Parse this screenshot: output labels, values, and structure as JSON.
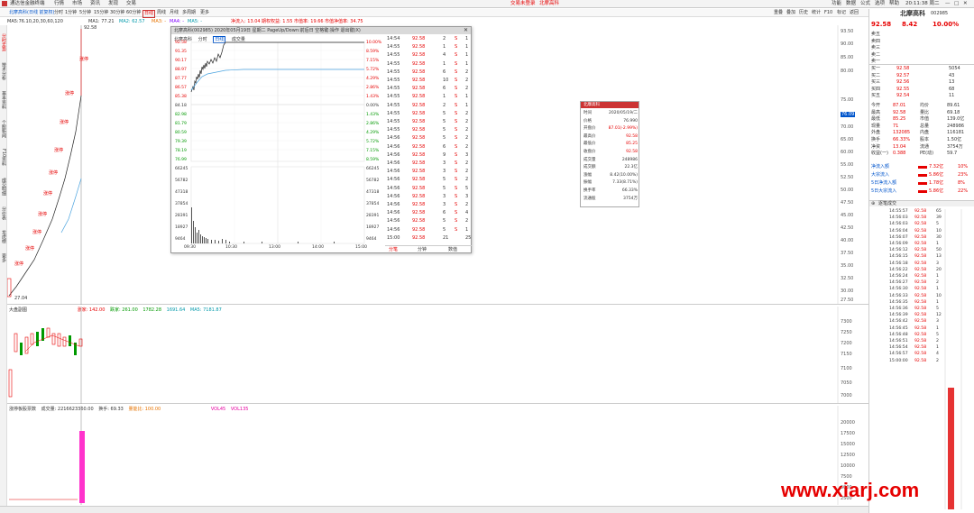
{
  "titlebar": {
    "app_name": "通达信金融终端",
    "menus": [
      "行情",
      "市场",
      "资讯",
      "发现",
      "交易"
    ],
    "status_text": "交易未登录",
    "stock_name": "北摩高科",
    "right_items": [
      "功能",
      "数据",
      "公式",
      "选项",
      "帮助"
    ],
    "clock": "20:11:38 周二"
  },
  "toolbar": {
    "left_items": [
      "北摩高科(日线 前复权)",
      "MA5",
      "MA10",
      "MA20",
      "MA30",
      "MA60",
      "MA120"
    ],
    "periods": [
      "分时",
      "1分钟",
      "5分钟",
      "15分钟",
      "30分钟",
      "60分钟",
      "日线",
      "周线",
      "月线",
      "多周期",
      "更多"
    ],
    "right_items": [
      "重叠",
      "叠加",
      "历史",
      "统计",
      "F10",
      "标记",
      "返回"
    ]
  },
  "infobar": {
    "ma_text": "MA5:76.10,20,30,60,120",
    "ma1": "MA1: 77.21",
    "ma2": "MA2: 62.57",
    "ma3": "MA3: -",
    "ma4": "MA4: -",
    "ma5": "MA5: -",
    "flow1": "净流入: 13.04",
    "flow2": "期权权益: 1.55",
    "flow3": "市值率: 19.66",
    "flow4": "市值净值率: 34.75"
  },
  "lefttabs": [
    "分时走势",
    "技术分析",
    "基本资料",
    "个股新闻",
    "F10资料",
    "成交明细",
    "分价表",
    "龙虎榜",
    "更多"
  ],
  "mainchart": {
    "top_price": "92.58",
    "low_price": "27.04",
    "labels": [
      "涨停",
      "涨停",
      "涨停",
      "涨停",
      "涨停",
      "涨停",
      "涨停",
      "涨停",
      "涨停",
      "涨停"
    ],
    "axis": [
      "93.50",
      "90.00",
      "85.00",
      "80.00",
      "76.09",
      "75.00",
      "70.00",
      "65.00",
      "60.00",
      "55.00",
      "52.50",
      "50.00",
      "47.50",
      "45.00",
      "42.50",
      "40.00",
      "37.50",
      "35.00",
      "32.50",
      "30.00",
      "27.50"
    ]
  },
  "volchart": {
    "title": "大盘副图",
    "axis": [
      "7300",
      "7250",
      "7200",
      "7150",
      "7100",
      "7050",
      "7000"
    ],
    "vals": [
      "涨家: 142.00",
      "跌家: 261.00",
      "1782.28",
      "1691.64",
      "MA5: 7181.87"
    ]
  },
  "indchart": {
    "title": "涨停板股票数",
    "vals": [
      "成交量: 2216623360.00",
      "换手: 69.33",
      "量能比: 100.00",
      "VOL45",
      "VOL135"
    ],
    "axis": [
      "20000",
      "17500",
      "15000",
      "12500",
      "10000",
      "7500",
      "5000",
      "2500"
    ]
  },
  "popup": {
    "title": "北摩高科(002985)  2020年05月19日  星期二  PageUp/Down:前后日  空格键:操作  退出键(X)",
    "tabs": [
      "北摩高科",
      "分时",
      "日线",
      "成交量"
    ],
    "left_axis": [
      "92.58",
      "91.35",
      "90.17",
      "88.97",
      "87.77",
      "86.57",
      "85.38",
      "84.18",
      "82.98",
      "81.79",
      "80.59",
      "79.39",
      "78.19",
      "76.99"
    ],
    "right_axis": [
      "10.00%",
      "8.59%",
      "7.15%",
      "5.72%",
      "4.29%",
      "2.86%",
      "1.43%",
      "0.00%",
      "1.43%",
      "2.86%",
      "4.29%",
      "5.72%",
      "7.15%",
      "8.59%"
    ],
    "vol_axis": [
      "66245",
      "56782",
      "47318",
      "37854",
      "28391",
      "18927",
      "9464"
    ],
    "time_axis": [
      "09:30",
      "10:30",
      "13:00",
      "14:00",
      "15:00"
    ],
    "ticks": [
      {
        "t": "14:54",
        "p": "92.58",
        "v": "2",
        "d": "S",
        "n": "1"
      },
      {
        "t": "14:55",
        "p": "92.58",
        "v": "1",
        "d": "S",
        "n": "1"
      },
      {
        "t": "14:55",
        "p": "92.58",
        "v": "4",
        "d": "S",
        "n": "1"
      },
      {
        "t": "14:55",
        "p": "92.58",
        "v": "1",
        "d": "S",
        "n": "1"
      },
      {
        "t": "14:55",
        "p": "92.58",
        "v": "6",
        "d": "S",
        "n": "2"
      },
      {
        "t": "14:55",
        "p": "92.58",
        "v": "10",
        "d": "S",
        "n": "2"
      },
      {
        "t": "14:55",
        "p": "92.58",
        "v": "6",
        "d": "S",
        "n": "2"
      },
      {
        "t": "14:55",
        "p": "92.58",
        "v": "1",
        "d": "S",
        "n": "1"
      },
      {
        "t": "14:55",
        "p": "92.58",
        "v": "2",
        "d": "S",
        "n": "1"
      },
      {
        "t": "14:55",
        "p": "92.58",
        "v": "5",
        "d": "S",
        "n": "2"
      },
      {
        "t": "14:55",
        "p": "92.58",
        "v": "5",
        "d": "S",
        "n": "2"
      },
      {
        "t": "14:55",
        "p": "92.58",
        "v": "5",
        "d": "S",
        "n": "2"
      },
      {
        "t": "14:56",
        "p": "92.58",
        "v": "5",
        "d": "S",
        "n": "2"
      },
      {
        "t": "14:56",
        "p": "92.58",
        "v": "6",
        "d": "S",
        "n": "2"
      },
      {
        "t": "14:56",
        "p": "92.58",
        "v": "9",
        "d": "S",
        "n": "3"
      },
      {
        "t": "14:56",
        "p": "92.58",
        "v": "3",
        "d": "S",
        "n": "2"
      },
      {
        "t": "14:56",
        "p": "92.58",
        "v": "3",
        "d": "S",
        "n": "2"
      },
      {
        "t": "14:56",
        "p": "92.58",
        "v": "5",
        "d": "S",
        "n": "2"
      },
      {
        "t": "14:56",
        "p": "92.58",
        "v": "5",
        "d": "S",
        "n": "5"
      },
      {
        "t": "14:56",
        "p": "92.58",
        "v": "3",
        "d": "S",
        "n": "3"
      },
      {
        "t": "14:56",
        "p": "92.58",
        "v": "3",
        "d": "S",
        "n": "2"
      },
      {
        "t": "14:56",
        "p": "92.58",
        "v": "6",
        "d": "S",
        "n": "4"
      },
      {
        "t": "14:56",
        "p": "92.58",
        "v": "5",
        "d": "S",
        "n": "2"
      },
      {
        "t": "14:56",
        "p": "92.58",
        "v": "5",
        "d": "S",
        "n": "1"
      },
      {
        "t": "15:00",
        "p": "92.58",
        "v": "21",
        "d": "",
        "n": "25"
      }
    ],
    "foot": [
      "分笔",
      "分钟",
      "数值"
    ]
  },
  "tooltip": {
    "title": "北摩高科",
    "rows": [
      {
        "k": "时间",
        "v": "2020/05/19/二"
      },
      {
        "k": "价格",
        "v": "76.990"
      },
      {
        "k": "开盘价",
        "v": "87.01(-2.99%)"
      },
      {
        "k": "最高价",
        "v": "92.58"
      },
      {
        "k": "最低价",
        "v": "85.25"
      },
      {
        "k": "收盘价",
        "v": "92.58"
      },
      {
        "k": "成交量",
        "v": "248986"
      },
      {
        "k": "成交额",
        "v": "22.3亿"
      },
      {
        "k": "涨幅",
        "v": "8.42(10.00%)"
      },
      {
        "k": "振幅",
        "v": "7.33(8.71%)"
      },
      {
        "k": "换手率",
        "v": "66.33%"
      },
      {
        "k": "流通股",
        "v": "3754万"
      }
    ]
  },
  "rightpanel": {
    "name": "北摩高科",
    "code": "002985",
    "price": "92.58",
    "change": "8.42",
    "pct": "10.00%",
    "sells": [
      {
        "k": "卖五",
        "p": "",
        "v": ""
      },
      {
        "k": "卖四",
        "p": "",
        "v": ""
      },
      {
        "k": "卖三",
        "p": "",
        "v": ""
      },
      {
        "k": "卖二",
        "p": "",
        "v": ""
      },
      {
        "k": "卖一",
        "p": "",
        "v": ""
      }
    ],
    "buys": [
      {
        "k": "买一",
        "p": "92.58",
        "v": "5054"
      },
      {
        "k": "买二",
        "p": "92.57",
        "v": "43"
      },
      {
        "k": "买三",
        "p": "92.56",
        "v": "13"
      },
      {
        "k": "买四",
        "p": "92.55",
        "v": "68"
      },
      {
        "k": "买五",
        "p": "92.54",
        "v": "11"
      }
    ],
    "stats": [
      {
        "k": "今开",
        "v": "87.01",
        "k2": "均价",
        "v2": "89.61"
      },
      {
        "k": "最高",
        "v": "92.58",
        "k2": "量比",
        "v2": "69.18"
      },
      {
        "k": "最低",
        "v": "85.25",
        "k2": "市值",
        "v2": "139.0亿"
      },
      {
        "k": "现量",
        "v": "71",
        "k2": "总量",
        "v2": "248986"
      },
      {
        "k": "外盘",
        "v": "132085",
        "k2": "内盘",
        "v2": "116181"
      },
      {
        "k": "换手",
        "v": "66.33%",
        "k2": "股本",
        "v2": "1.50亿"
      },
      {
        "k": "净资",
        "v": "13.04",
        "k2": "流通",
        "v2": "3754万"
      },
      {
        "k": "收益(一)",
        "v": "0.388",
        "k2": "PE(动)",
        "v2": "59.7"
      }
    ],
    "flows": [
      {
        "k": "净流入额",
        "v": "7.32亿",
        "p": "10%"
      },
      {
        "k": "大宗流入",
        "v": "5.86亿",
        "p": "23%"
      },
      {
        "k": "5日净流入额",
        "v": "1.78亿",
        "p": "8%"
      },
      {
        "k": "5日大宗流入",
        "v": "5.86亿",
        "p": "22%"
      }
    ],
    "trades_title": "逐笔成交",
    "trades": [
      {
        "t": "14:55:57",
        "p": "92.58",
        "v": "65"
      },
      {
        "t": "14:56:03",
        "p": "92.58",
        "v": "39"
      },
      {
        "t": "14:56:03",
        "p": "92.58",
        "v": "5"
      },
      {
        "t": "14:56:04",
        "p": "92.58",
        "v": "10"
      },
      {
        "t": "14:56:07",
        "p": "92.58",
        "v": "30"
      },
      {
        "t": "14:56:09",
        "p": "92.58",
        "v": "1"
      },
      {
        "t": "14:56:12",
        "p": "92.58",
        "v": "50"
      },
      {
        "t": "14:56:15",
        "p": "92.58",
        "v": "13"
      },
      {
        "t": "14:56:18",
        "p": "92.58",
        "v": "3"
      },
      {
        "t": "14:56:22",
        "p": "92.58",
        "v": "20"
      },
      {
        "t": "14:56:24",
        "p": "92.58",
        "v": "1"
      },
      {
        "t": "14:56:27",
        "p": "92.58",
        "v": "2"
      },
      {
        "t": "14:56:30",
        "p": "92.58",
        "v": "1"
      },
      {
        "t": "14:56:33",
        "p": "92.58",
        "v": "10"
      },
      {
        "t": "14:56:35",
        "p": "92.58",
        "v": "1"
      },
      {
        "t": "14:56:36",
        "p": "92.58",
        "v": "5"
      },
      {
        "t": "14:56:39",
        "p": "92.58",
        "v": "12"
      },
      {
        "t": "14:56:42",
        "p": "92.58",
        "v": "3"
      },
      {
        "t": "14:56:45",
        "p": "92.58",
        "v": "1"
      },
      {
        "t": "14:56:48",
        "p": "92.58",
        "v": "5"
      },
      {
        "t": "14:56:51",
        "p": "92.58",
        "v": "2"
      },
      {
        "t": "14:56:54",
        "p": "92.58",
        "v": "1"
      },
      {
        "t": "14:56:57",
        "p": "92.58",
        "v": "4"
      },
      {
        "t": "15:00:00",
        "p": "92.58",
        "v": "2"
      }
    ]
  },
  "watermark": "www.xiarj.com",
  "colors": {
    "up": "#e60000",
    "down": "#009900",
    "accent": "#0055cc"
  }
}
